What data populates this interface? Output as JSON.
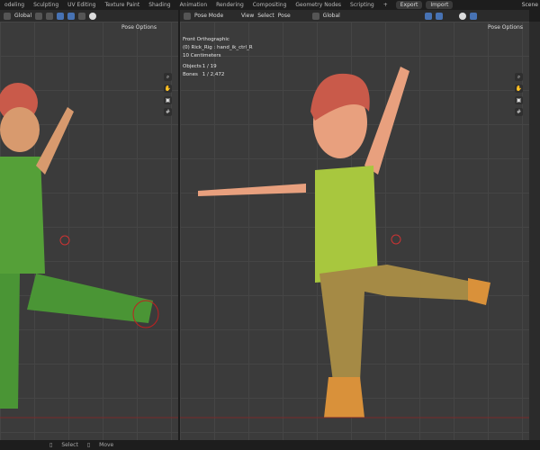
{
  "workspaces": [
    "odeling",
    "Sculpting",
    "UV Editing",
    "Texture Paint",
    "Shading",
    "Animation",
    "Rendering",
    "Compositing",
    "Geometry Nodes",
    "Scripting"
  ],
  "topbar": {
    "add": "+",
    "export": "Export",
    "import": "Import",
    "scene": "Scene"
  },
  "left_header": {
    "orientation": "Global",
    "pose_options": "Pose Options"
  },
  "right_header": {
    "mode": "Pose Mode",
    "menus": [
      "View",
      "Select",
      "Pose"
    ],
    "orientation": "Global",
    "pose_options": "Pose Options"
  },
  "overlay": {
    "view": "Front Orthographic",
    "object": "(0) Rick_Rig : hand_ik_ctrl_R",
    "scale": "10 Centimeters",
    "objects_label": "Objects",
    "objects_value": "1 / 19",
    "bones_label": "Bones",
    "bones_value": "1 / 2,472"
  },
  "status": {
    "select": "Select",
    "move": "Move"
  },
  "colors": {
    "shirt": "#a8c73e",
    "pants": "#a58a45",
    "hair": "#c95a4a",
    "skin": "#e8a07e"
  }
}
